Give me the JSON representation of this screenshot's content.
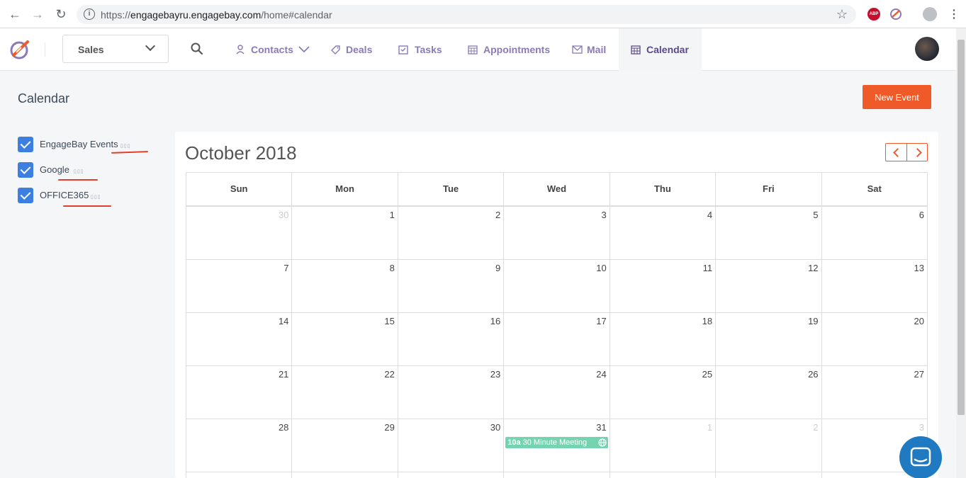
{
  "browser": {
    "url_scheme": "https://",
    "url_host": "engagebayru.engagebay.com",
    "url_path": "/home#calendar",
    "extension_abp": "ABP"
  },
  "nav": {
    "module_select": "Sales",
    "items": [
      {
        "label": "Contacts",
        "icon": "user-icon"
      },
      {
        "label": "Deals",
        "icon": "tag-icon"
      },
      {
        "label": "Tasks",
        "icon": "task-icon"
      },
      {
        "label": "Appointments",
        "icon": "calendar-grid-icon"
      },
      {
        "label": "Mail",
        "icon": "mail-icon"
      },
      {
        "label": "Calendar",
        "icon": "calendar-icon"
      }
    ],
    "active": "Calendar"
  },
  "page": {
    "title": "Calendar",
    "new_event_label": "New Event"
  },
  "calendars": [
    {
      "label": "EngageBay Events",
      "checked": true
    },
    {
      "label": "Google",
      "checked": true
    },
    {
      "label": "OFFICE365",
      "checked": true
    }
  ],
  "calendar": {
    "month_title": "October 2018",
    "weekdays": [
      "Sun",
      "Mon",
      "Tue",
      "Wed",
      "Thu",
      "Fri",
      "Sat"
    ],
    "weeks": [
      [
        "30",
        "1",
        "2",
        "3",
        "4",
        "5",
        "6"
      ],
      [
        "7",
        "8",
        "9",
        "10",
        "11",
        "12",
        "13"
      ],
      [
        "14",
        "15",
        "16",
        "17",
        "18",
        "19",
        "20"
      ],
      [
        "21",
        "22",
        "23",
        "24",
        "25",
        "26",
        "27"
      ],
      [
        "28",
        "29",
        "30",
        "31",
        "1",
        "2",
        "3"
      ]
    ],
    "event": {
      "time": "10a",
      "title": "30 Minute Meeting",
      "icon": "globe-icon"
    }
  },
  "colors": {
    "accent": "#f05a28",
    "nav_text": "#8a7bb6",
    "checkbox": "#3d7fe0",
    "event": "#74d4b0",
    "chat": "#1f7ac1"
  }
}
